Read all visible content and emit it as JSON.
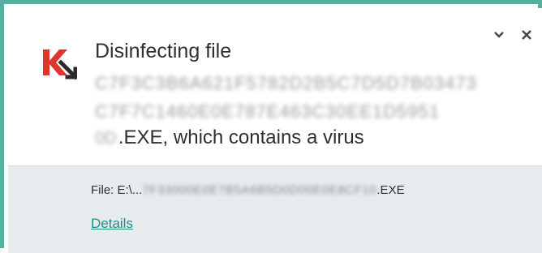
{
  "notification": {
    "title": "Disinfecting file",
    "blurred_line1": "C7F3C3B6A621F5782D2B5C7D5D7B03473",
    "blurred_line2": "C7F7C1460E0E787E463C30EE1D5951",
    "blurred_line3_prefix": "0D",
    "message_suffix": ".EXE, which contains a virus",
    "file_label": "File: E:\\...",
    "file_blurred": "7F33000E0E7B5A6B5D0D00E0E8CF10",
    "file_ext": ".EXE",
    "details_link": "Details"
  },
  "controls": {
    "collapse_icon": "chevron-down-icon",
    "close_icon": "close-icon"
  },
  "colors": {
    "accent_border": "#52b09e",
    "footer_bg": "#e6ebee",
    "link": "#1f8f83",
    "logo_red": "#e0352f",
    "logo_dark": "#2b2b2b"
  }
}
